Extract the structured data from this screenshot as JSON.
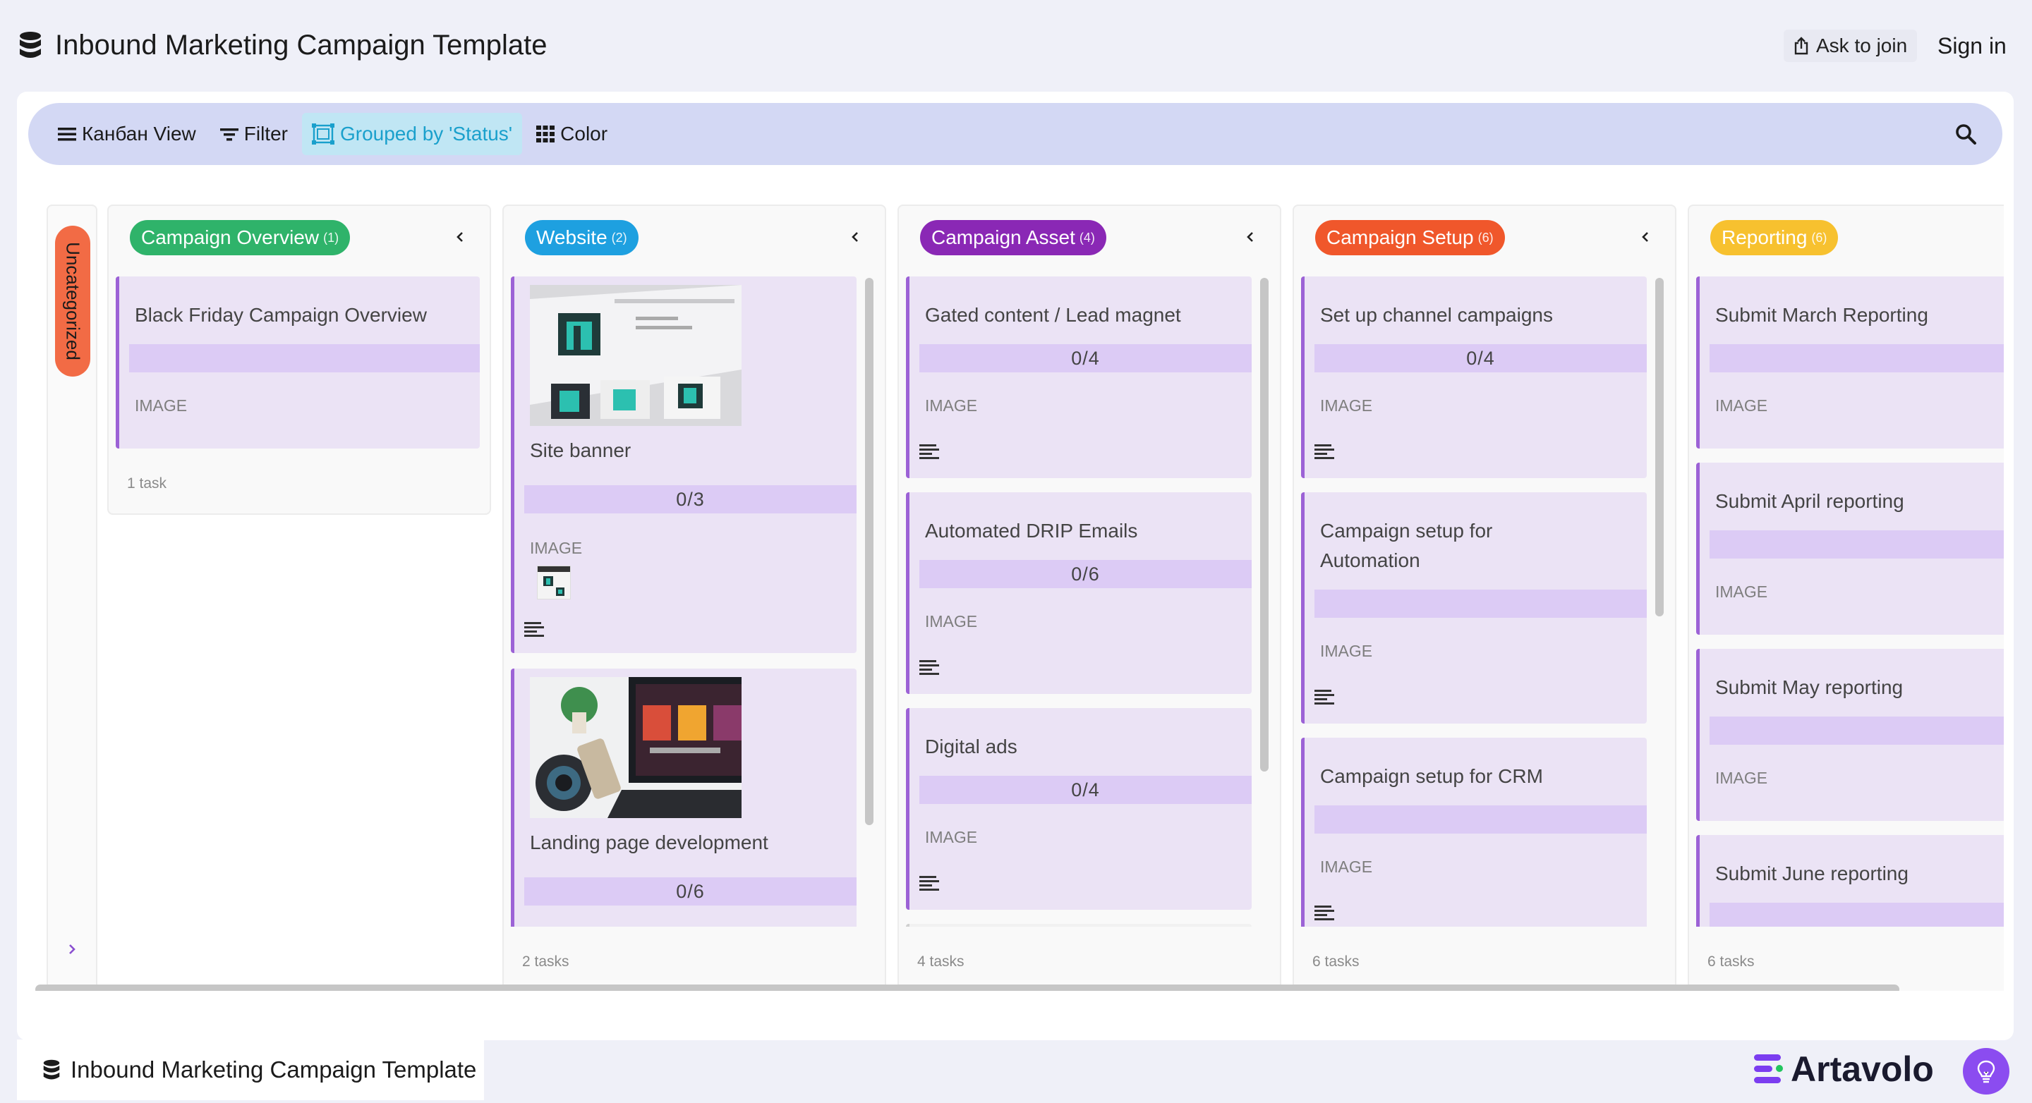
{
  "app": {
    "title": "Inbound Marketing Campaign Template"
  },
  "header": {
    "ask_to_join": "Ask to join",
    "sign_in": "Sign in"
  },
  "toolbar": {
    "view_label": "Канбан View",
    "filter_label": "Filter",
    "group_label": "Grouped by 'Status'",
    "color_label": "Color"
  },
  "uncategorized": {
    "label": "Uncategorized"
  },
  "columns": [
    {
      "title": "Campaign Overview",
      "count": "(1)",
      "color": "#2fb36a",
      "footer": "1 task",
      "cards": [
        {
          "title": "Black Friday Campaign Overview",
          "image_label": "IMAGE"
        }
      ]
    },
    {
      "title": "Website",
      "count": "(2)",
      "color": "#1ea0e0",
      "footer": "2 tasks",
      "cards": [
        {
          "title": "Site banner",
          "progress": "0/3",
          "image_label": "IMAGE"
        },
        {
          "title": "Landing page development",
          "progress": "0/6"
        }
      ]
    },
    {
      "title": "Campaign Asset",
      "count": "(4)",
      "color": "#8a28b5",
      "footer": "4 tasks",
      "cards": [
        {
          "title": "Gated content / Lead magnet",
          "progress": "0/4",
          "image_label": "IMAGE"
        },
        {
          "title": "Automated DRIP Emails",
          "progress": "0/6",
          "image_label": "IMAGE"
        },
        {
          "title": "Digital ads",
          "progress": "0/4",
          "image_label": "IMAGE"
        }
      ]
    },
    {
      "title": "Campaign Setup",
      "count": "(6)",
      "color": "#f0572b",
      "footer": "6 tasks",
      "cards": [
        {
          "title": "Set up channel campaigns",
          "progress": "0/4",
          "image_label": "IMAGE"
        },
        {
          "title": "Campaign setup for Automation",
          "image_label": "IMAGE"
        },
        {
          "title": "Campaign setup for CRM",
          "image_label": "IMAGE"
        }
      ]
    },
    {
      "title": "Reporting",
      "count": "(6)",
      "color": "#f7c12f",
      "footer": "6 tasks",
      "cards": [
        {
          "title": "Submit March Reporting",
          "image_label": "IMAGE"
        },
        {
          "title": "Submit April reporting",
          "image_label": "IMAGE"
        },
        {
          "title": "Submit May reporting",
          "image_label": "IMAGE"
        },
        {
          "title": "Submit June reporting"
        }
      ]
    }
  ],
  "footer": {
    "tab_title": "Inbound Marketing Campaign Template",
    "brand": "Artavolo"
  },
  "icons": {
    "app": "database-icon",
    "ask": "share-icon",
    "view": "menu-icon",
    "filter": "filter-icon",
    "group": "group-icon",
    "color": "grid-icon",
    "search": "search-icon",
    "bulb": "lightbulb-icon"
  }
}
